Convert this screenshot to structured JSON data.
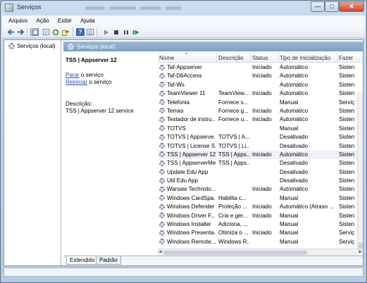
{
  "window": {
    "title": "Serviços",
    "minimize_glyph": "—",
    "maximize_glyph": "□",
    "close_glyph": "✕"
  },
  "menu": [
    "Arquivo",
    "Ação",
    "Exibir",
    "Ajuda"
  ],
  "toolbar_icons": [
    "back-arrow-icon",
    "forward-arrow-icon",
    "console-tree-icon",
    "properties-sheet-icon",
    "refresh-icon",
    "export-list-icon",
    "help-icon",
    "details-view-icon",
    "start-service-icon",
    "stop-service-icon",
    "pause-service-icon",
    "restart-service-icon"
  ],
  "tree": {
    "root_label": "Serviços (local)"
  },
  "header_band": {
    "label": "Serviços (local)"
  },
  "details": {
    "service_name": "TSS | Appserver 12",
    "stop_link": "Parar",
    "stop_suffix": " o serviço",
    "restart_link": "Reiniciar",
    "restart_suffix": " o serviço",
    "description_label": "Descrição:",
    "description_text": "TSS | Appserver 12 service"
  },
  "columns": {
    "name": "Nome",
    "description": "Descrição",
    "status": "Status",
    "startup": "Tipo de Inicialização",
    "logon": "Fazer"
  },
  "services": [
    {
      "name": "Taf-Appserver",
      "desc": "",
      "status": "Iniciado",
      "startup": "Automático",
      "logon": "Sisten"
    },
    {
      "name": "Taf-DbAccess",
      "desc": "",
      "status": "Iniciado",
      "startup": "Automático",
      "logon": "Sisten"
    },
    {
      "name": "Taf-Ws",
      "desc": "",
      "status": "",
      "startup": "Automático",
      "logon": "Sisten"
    },
    {
      "name": "TeamViewer 11",
      "desc": "TeamView...",
      "status": "Iniciado",
      "startup": "Automático",
      "logon": "Sisten"
    },
    {
      "name": "Telefonia",
      "desc": "Fornece s...",
      "status": "",
      "startup": "Manual",
      "logon": "Serviç"
    },
    {
      "name": "Temas",
      "desc": "Fornece g...",
      "status": "Iniciado",
      "startup": "Automático",
      "logon": "Sisten"
    },
    {
      "name": "Testador de instru...",
      "desc": "Fornece u...",
      "status": "Iniciado",
      "startup": "Automático",
      "logon": "Sisten"
    },
    {
      "name": "TOTVS",
      "desc": "",
      "status": "",
      "startup": "Manual",
      "logon": "Sisten"
    },
    {
      "name": "TOTVS | Appserve...",
      "desc": "TOTVS | A...",
      "status": "",
      "startup": "Desativado",
      "logon": "Sisten"
    },
    {
      "name": "TOTVS | License S...",
      "desc": "TOTVS | Li...",
      "status": "",
      "startup": "Desativado",
      "logon": "Sisten"
    },
    {
      "name": "TSS | Appserver 12",
      "desc": "TSS | Apps...",
      "status": "Iniciado",
      "startup": "Automático",
      "logon": "Sisten",
      "selected": true
    },
    {
      "name": "TSS | AppserverMeu",
      "desc": "TSS | Apps...",
      "status": "",
      "startup": "Desativado",
      "logon": "Sisten"
    },
    {
      "name": "Update Edu App",
      "desc": "",
      "status": "",
      "startup": "Desativado",
      "logon": "Sisten"
    },
    {
      "name": "Util Edu App",
      "desc": "",
      "status": "",
      "startup": "Desativado",
      "logon": "Sisten"
    },
    {
      "name": "Warsaw Technolo...",
      "desc": "",
      "status": "Iniciado",
      "startup": "Automático",
      "logon": "Sisten"
    },
    {
      "name": "Windows CardSpa...",
      "desc": "Habilita c...",
      "status": "",
      "startup": "Manual",
      "logon": "Sisten"
    },
    {
      "name": "Windows Defender",
      "desc": "Proteção ...",
      "status": "Iniciado",
      "startup": "Automático (Atraso ...",
      "logon": "Sisten"
    },
    {
      "name": "Windows Driver F...",
      "desc": "Cria e ger...",
      "status": "Iniciado",
      "startup": "Manual",
      "logon": "Sisten"
    },
    {
      "name": "Windows Installer",
      "desc": "Adiciona, ...",
      "status": "",
      "startup": "Manual",
      "logon": "Sisten"
    },
    {
      "name": "Windows Presenta...",
      "desc": "Otimiza o ...",
      "status": "Iniciado",
      "startup": "Manual",
      "logon": "Serviç"
    },
    {
      "name": "Windows Remote...",
      "desc": "Windows R...",
      "status": "",
      "startup": "Manual",
      "logon": "Serviç"
    }
  ],
  "tabs": [
    "Estendido",
    "Padrão"
  ]
}
